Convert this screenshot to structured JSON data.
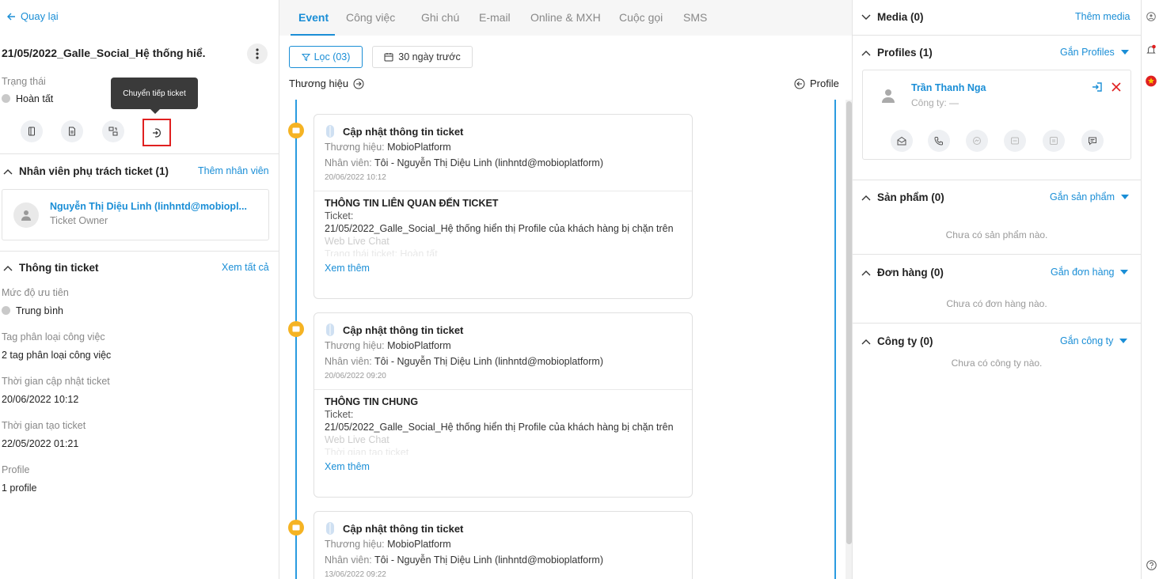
{
  "left": {
    "back_label": "Quay lại",
    "ticket_title": "21/05/2022_Galle_Social_Hệ thống hiể...",
    "status_label": "Trạng thái",
    "status_value": "Hoàn tất",
    "tooltip": "Chuyển tiếp ticket",
    "staff_section": {
      "title": "Nhân viên phụ trách ticket (1)",
      "add_link": "Thêm nhân viên",
      "staff_name": "Nguyễn Thị Diệu Linh (linhntd@mobiopl...",
      "staff_role": "Ticket Owner"
    },
    "info_section": {
      "title": "Thông tin ticket",
      "view_all": "Xem tất cả",
      "fields": [
        {
          "label": "Mức độ ưu tiên",
          "value": "Trung bình"
        },
        {
          "label": "Tag phân loại công việc",
          "value": "2 tag phân loại công việc"
        },
        {
          "label": "Thời gian cập nhật ticket",
          "value": "20/06/2022 10:12"
        },
        {
          "label": "Thời gian tạo ticket",
          "value": "22/05/2022 01:21"
        },
        {
          "label": "Profile",
          "value": "1 profile"
        }
      ]
    }
  },
  "mid": {
    "tabs": [
      "Event",
      "Công việc",
      "Ghi chú",
      "E-mail",
      "Online & MXH",
      "Cuộc gọi",
      "SMS"
    ],
    "filter_label": "Lọc (03)",
    "date_label": "30 ngày trước",
    "left_head": "Thương hiệu",
    "right_head": "Profile",
    "events": [
      {
        "title": "Cập nhật thông tin ticket",
        "brand_label": "Thương hiệu:",
        "brand": "MobioPlatform",
        "staff_label": "Nhân viên:",
        "staff": "Tôi - Nguyễn Thị Diệu Linh (linhntd@mobioplatform)",
        "time": "20/06/2022 10:12",
        "body_title": "THÔNG TIN LIÊN QUAN ĐẾN TICKET",
        "body_label": "Ticket:",
        "body_value": "21/05/2022_Galle_Social_Hệ thống hiển thị Profile của khách hàng bị chặn trên",
        "body_fade": "Web Live Chat",
        "body_fade2": "Trạng thái ticket: Hoàn tất",
        "more": "Xem thêm"
      },
      {
        "title": "Cập nhật thông tin ticket",
        "brand_label": "Thương hiệu:",
        "brand": "MobioPlatform",
        "staff_label": "Nhân viên:",
        "staff": "Tôi - Nguyễn Thị Diệu Linh (linhntd@mobioplatform)",
        "time": "20/06/2022 09:20",
        "body_title": "THÔNG TIN CHUNG",
        "body_label": "Ticket:",
        "body_value": "21/05/2022_Galle_Social_Hệ thống hiển thị Profile của khách hàng bị chặn trên",
        "body_fade": "Web Live Chat",
        "body_fade2": "Thời gian tạo ticket",
        "more": "Xem thêm"
      },
      {
        "title": "Cập nhật thông tin ticket",
        "brand_label": "Thương hiệu:",
        "brand": "MobioPlatform",
        "staff_label": "Nhân viên:",
        "staff": "Tôi - Nguyễn Thị Diệu Linh (linhntd@mobioplatform)",
        "time": "13/06/2022 09:22"
      }
    ]
  },
  "right": {
    "media": {
      "title": "Media (0)",
      "link": "Thêm media"
    },
    "profiles": {
      "title": "Profiles (1)",
      "link": "Gắn Profiles",
      "name": "Trần Thanh Nga",
      "company": "Công ty: —"
    },
    "products": {
      "title": "Sản phẩm (0)",
      "link": "Gắn sản phẩm",
      "empty": "Chưa có sản phẩm nào."
    },
    "orders": {
      "title": "Đơn hàng (0)",
      "link": "Gắn đơn hàng",
      "empty": "Chưa có đơn hàng nào."
    },
    "companies": {
      "title": "Công ty (0)",
      "link": "Gắn công ty",
      "empty": "Chưa có công ty nào."
    }
  },
  "colors": {
    "accent": "#1a8ed6",
    "timeline_dot": "#f5b323",
    "highlight": "#e02020"
  }
}
